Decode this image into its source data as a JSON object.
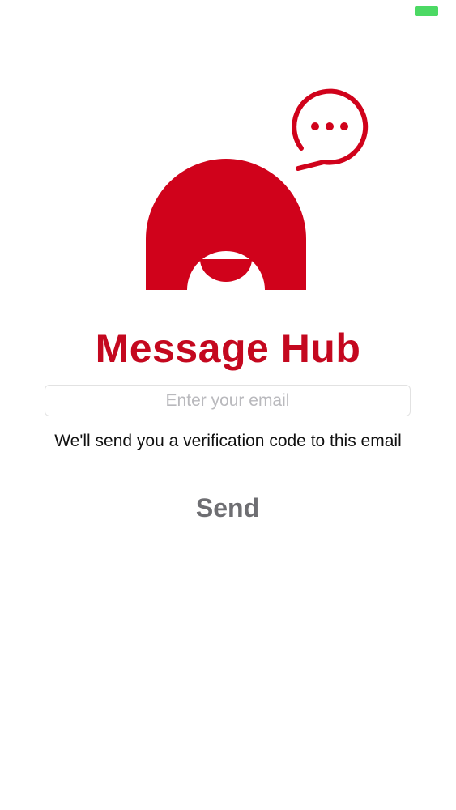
{
  "status_bar": {
    "battery_color": "#4cd964"
  },
  "logo": {
    "icon": "message-hub-logo-icon",
    "bubble_icon": "chat-bubble-ellipsis-icon",
    "brand_color": "#d0021b"
  },
  "app_title": "Message Hub",
  "email_input": {
    "value": "",
    "placeholder": "Enter your email"
  },
  "helper_text": "We'll send you a verification code to this email",
  "send_button": {
    "label": "Send",
    "color": "#6e6e72"
  }
}
